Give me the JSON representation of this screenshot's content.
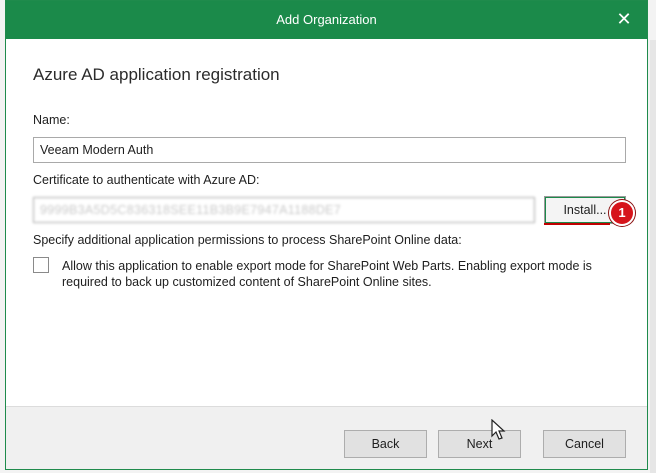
{
  "window": {
    "title": "Add Organization",
    "close_glyph": "✕"
  },
  "content": {
    "heading": "Azure AD application registration",
    "name_label": "Name:",
    "name_value": "Veeam Modern Auth",
    "cert_label": "Certificate to authenticate with Azure AD:",
    "cert_value": "9999B3A5D5C836318SEE11B3B9E7947A1188DE7",
    "install_label": "Install...",
    "permissions_label": "Specify additional application permissions to process SharePoint Online data:",
    "export_checkbox_label": "Allow this application to enable export mode for SharePoint Web Parts. Enabling export mode is required to back up customized content of SharePoint Online sites.",
    "export_checkbox_checked": false
  },
  "annotation": {
    "step_number": "1",
    "color": "#d6141b"
  },
  "footer": {
    "back_label": "Back",
    "next_label": "Next",
    "cancel_label": "Cancel"
  },
  "colors": {
    "titlebar": "#1b8a4a"
  }
}
